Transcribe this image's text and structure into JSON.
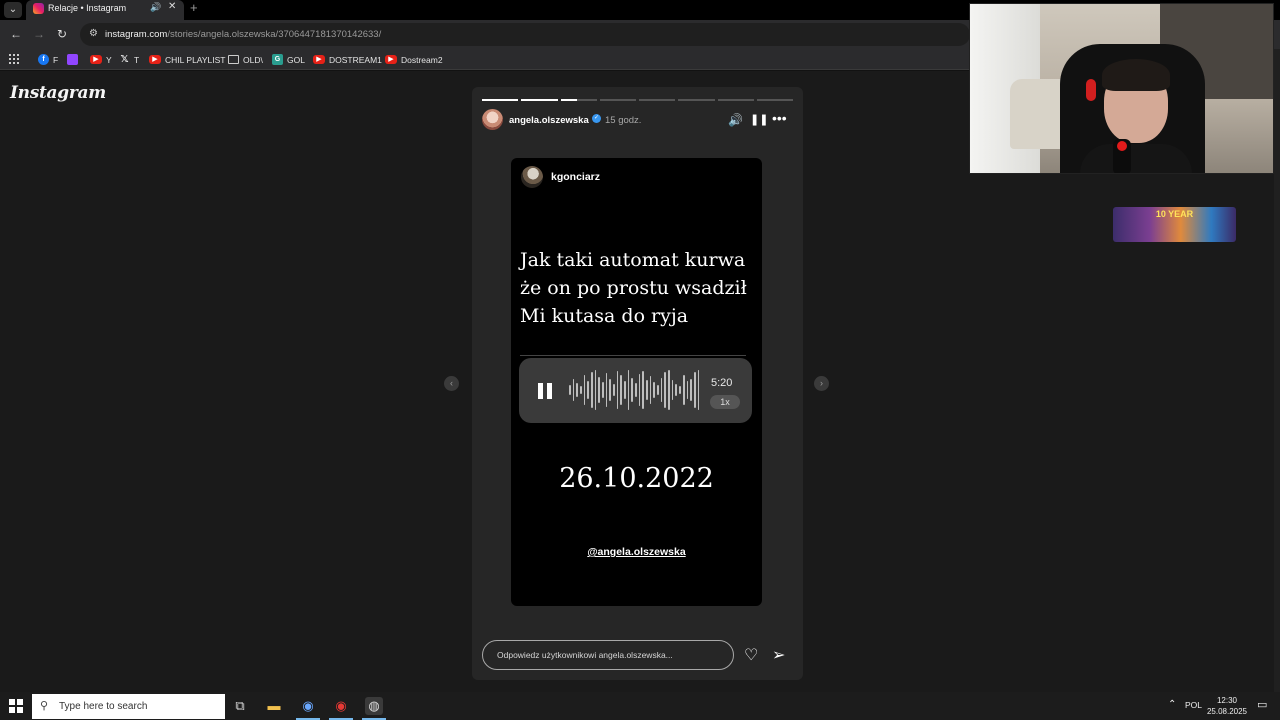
{
  "browser": {
    "tab_title": "Relacje • Instagram",
    "tab_close": "✕",
    "new_tab": "+",
    "url_host": "instagram.com",
    "url_path": "/stories/angela.olszewska/3706447181370142633/",
    "bookmarks": [
      {
        "label": "F",
        "icon": "facebook-icon"
      },
      {
        "label": "",
        "icon": "twitch-icon"
      },
      {
        "label": "Y",
        "icon": "youtube-icon"
      },
      {
        "label": "T",
        "icon": "x-icon"
      },
      {
        "label": "CHIL PLAYLIST",
        "icon": "youtube-icon"
      },
      {
        "label": "OLD\\",
        "icon": "folder-icon"
      },
      {
        "label": "GOL",
        "icon": "g-icon"
      },
      {
        "label": "DOSTREAM1",
        "icon": "youtube-icon"
      },
      {
        "label": "Dostream2",
        "icon": "youtube-icon"
      }
    ]
  },
  "instagram": {
    "logo": "Instagram",
    "story": {
      "username": "angela.olszewska",
      "time": "15 godz.",
      "progress": [
        1,
        1,
        0.45,
        0,
        0,
        0,
        0,
        0
      ],
      "card": {
        "author": "kgonciarz",
        "text": "Jak taki automat kurwa\nże on po prostu wsadził\nMi kutasa do ryja",
        "voice_duration": "5:20",
        "voice_speed": "1x",
        "date": "26.10.2022",
        "mention": "@angela.olszewska"
      },
      "reply_placeholder": "Odpowiedz użytkownikowi angela.olszewska..."
    }
  },
  "banner": {
    "text": "10 YEAR"
  },
  "taskbar": {
    "search_placeholder": "Type here to search",
    "lang": "POL",
    "time": "12:30",
    "date": "25.08.2025"
  },
  "colors": {
    "accent": "#3897f0",
    "voice_bubble": "#3a3a3a",
    "story_bg": "#262626"
  }
}
